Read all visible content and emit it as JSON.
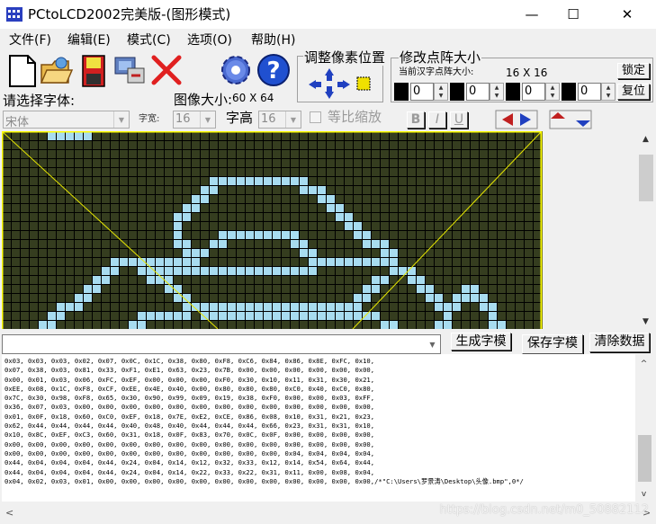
{
  "window": {
    "title": "PCtoLCD2002完美版-(图形模式)",
    "minimize_glyph": "—",
    "maximize_glyph": "☐",
    "close_glyph": "✕"
  },
  "menu": [
    "文件(F)",
    "编辑(E)",
    "模式(C)",
    "选项(O)",
    "帮助(H)"
  ],
  "toolbar": {
    "icons": [
      "new-file-icon",
      "open-folder-icon",
      "save-disk-icon",
      "export-icon",
      "close-x-icon",
      "settings-gear-icon",
      "help-icon"
    ]
  },
  "font_panel": {
    "choose_font_label": "请选择字体:",
    "font_value": "宋体",
    "font_width_label": "字宽:",
    "font_width_value": "16",
    "font_height_label": "字高",
    "font_height_value": "16",
    "proportional_label": "等比缩放",
    "bold_label": "B",
    "italic_label": "I",
    "underline_label": "U"
  },
  "image_size": {
    "label": "图像大小:",
    "value": "60 X 64"
  },
  "adjust_panel": {
    "title": "调整像素位置"
  },
  "dot_panel": {
    "title": "修改点阵大小",
    "current_label": "当前汉字点阵大小:",
    "current_value": "16 X 16",
    "lock_label": "锁定",
    "reset_label": "复位",
    "spin_values": [
      "0",
      "0",
      "0",
      "0"
    ]
  },
  "action_buttons": {
    "generate_label": "生成字模",
    "save_label": "保存字模",
    "clear_label": "清除数据"
  },
  "output_lines": [
    "0x03, 0x03, 0x03, 0x02, 0x07, 0x0C, 0x1C, 0x38, 0x80, 0xF8, 0xC6, 0x84, 0x86, 0x8E, 0xFC, 0x10,",
    "0x07, 0x38, 0x03, 0x81, 0x33, 0xF1, 0xE1, 0x63, 0x23, 0x7B, 0x00, 0x00, 0x00, 0x00, 0x00, 0x00,",
    "0x00, 0x01, 0x03, 0x06, 0xFC, 0xEF, 0x00, 0x00, 0x00, 0xF0, 0x30, 0x10, 0x11, 0x31, 0x30, 0x21,",
    "0xEE, 0x08, 0x1C, 0xF8, 0xCF, 0xEE, 0x4E, 0x40, 0x00, 0x80, 0x80, 0x80, 0xC0, 0x40, 0xC0, 0x80,",
    "0x7C, 0x30, 0x98, 0xF8, 0x65, 0x30, 0x90, 0x99, 0x09, 0x19, 0x38, 0xF0, 0x00, 0x00, 0x03, 0xFF,",
    "0x36, 0x07, 0x03, 0x00, 0x00, 0x00, 0x00, 0x00, 0x00, 0x00, 0x00, 0x00, 0x00, 0x00, 0x00, 0x00,",
    "0x01, 0x0F, 0x18, 0x60, 0xC0, 0xEF, 0x18, 0x7E, 0xE2, 0xCE, 0x86, 0x08, 0x10, 0x31, 0x21, 0x23,",
    "0x62, 0x44, 0x44, 0x44, 0x44, 0x40, 0x48, 0x40, 0x44, 0x44, 0x44, 0x66, 0x23, 0x31, 0x31, 0x10,",
    "0x10, 0x8C, 0xEF, 0xC3, 0x60, 0x31, 0x18, 0x0F, 0x83, 0x70, 0x0C, 0x0F, 0x00, 0x00, 0x00, 0x00,",
    "0x00, 0x00, 0x00, 0x00, 0x00, 0x00, 0x00, 0x00, 0x00, 0x00, 0x00, 0x00, 0x00, 0x00, 0x00, 0x00,",
    "0x00, 0x00, 0x00, 0x00, 0x00, 0x00, 0x00, 0x00, 0x00, 0x00, 0x00, 0x00, 0x04, 0x04, 0x04, 0x04,",
    "0x44, 0x04, 0x04, 0x04, 0x44, 0x24, 0x04, 0x14, 0x12, 0x32, 0x33, 0x12, 0x14, 0x54, 0x64, 0x44,",
    "0x44, 0x04, 0x04, 0x04, 0x44, 0x24, 0x04, 0x14, 0x22, 0x33, 0x22, 0x31, 0x11, 0x00, 0x08, 0x04,",
    "0x04, 0x02, 0x03, 0x01, 0x00, 0x00, 0x00, 0x00, 0x00, 0x00, 0x00, 0x00, 0x00, 0x00, 0x00, 0x00,/*\"C:\\Users\\罗景涛\\Desktop\\头像.bmp\",0*/"
  ],
  "watermark": "https://blog.csdn.net/m0_50882112",
  "colors": {
    "grid_background": "#353d1f",
    "grid_line": "#000000",
    "pixel_on": "#a8dcf0",
    "guide_line": "#e8e800",
    "canvas_border": "#ffff00"
  },
  "glyph_grid": {
    "cols": 60,
    "rows": 22,
    "on_cells": [
      [
        5,
        0
      ],
      [
        6,
        0
      ],
      [
        7,
        0
      ],
      [
        8,
        0
      ],
      [
        9,
        0
      ],
      [
        23,
        5
      ],
      [
        24,
        5
      ],
      [
        25,
        5
      ],
      [
        26,
        5
      ],
      [
        27,
        5
      ],
      [
        28,
        5
      ],
      [
        29,
        5
      ],
      [
        30,
        5
      ],
      [
        31,
        5
      ],
      [
        32,
        5
      ],
      [
        33,
        5
      ],
      [
        22,
        6
      ],
      [
        23,
        6
      ],
      [
        33,
        6
      ],
      [
        34,
        6
      ],
      [
        35,
        6
      ],
      [
        21,
        7
      ],
      [
        22,
        7
      ],
      [
        35,
        7
      ],
      [
        36,
        7
      ],
      [
        20,
        8
      ],
      [
        21,
        8
      ],
      [
        36,
        8
      ],
      [
        37,
        8
      ],
      [
        19,
        9
      ],
      [
        20,
        9
      ],
      [
        37,
        9
      ],
      [
        38,
        9
      ],
      [
        19,
        10
      ],
      [
        38,
        10
      ],
      [
        39,
        10
      ],
      [
        19,
        11
      ],
      [
        24,
        11
      ],
      [
        25,
        11
      ],
      [
        26,
        11
      ],
      [
        27,
        11
      ],
      [
        28,
        11
      ],
      [
        29,
        11
      ],
      [
        30,
        11
      ],
      [
        31,
        11
      ],
      [
        32,
        11
      ],
      [
        39,
        11
      ],
      [
        40,
        11
      ],
      [
        19,
        12
      ],
      [
        20,
        12
      ],
      [
        23,
        12
      ],
      [
        24,
        12
      ],
      [
        32,
        12
      ],
      [
        33,
        12
      ],
      [
        40,
        12
      ],
      [
        41,
        12
      ],
      [
        42,
        12
      ],
      [
        20,
        13
      ],
      [
        21,
        13
      ],
      [
        22,
        13
      ],
      [
        33,
        13
      ],
      [
        34,
        13
      ],
      [
        42,
        13
      ],
      [
        43,
        13
      ],
      [
        12,
        14
      ],
      [
        13,
        14
      ],
      [
        14,
        14
      ],
      [
        15,
        14
      ],
      [
        16,
        14
      ],
      [
        17,
        14
      ],
      [
        18,
        14
      ],
      [
        19,
        14
      ],
      [
        20,
        14
      ],
      [
        21,
        14
      ],
      [
        34,
        14
      ],
      [
        35,
        14
      ],
      [
        36,
        14
      ],
      [
        37,
        14
      ],
      [
        38,
        14
      ],
      [
        39,
        14
      ],
      [
        40,
        14
      ],
      [
        41,
        14
      ],
      [
        42,
        14
      ],
      [
        43,
        14
      ],
      [
        11,
        15
      ],
      [
        12,
        15
      ],
      [
        15,
        15
      ],
      [
        16,
        15
      ],
      [
        17,
        15
      ],
      [
        18,
        15
      ],
      [
        19,
        15
      ],
      [
        20,
        15
      ],
      [
        21,
        15
      ],
      [
        22,
        15
      ],
      [
        23,
        15
      ],
      [
        24,
        15
      ],
      [
        25,
        15
      ],
      [
        26,
        15
      ],
      [
        27,
        15
      ],
      [
        28,
        15
      ],
      [
        29,
        15
      ],
      [
        30,
        15
      ],
      [
        31,
        15
      ],
      [
        32,
        15
      ],
      [
        33,
        15
      ],
      [
        34,
        15
      ],
      [
        43,
        15
      ],
      [
        44,
        15
      ],
      [
        45,
        15
      ],
      [
        10,
        16
      ],
      [
        11,
        16
      ],
      [
        16,
        16
      ],
      [
        17,
        16
      ],
      [
        18,
        16
      ],
      [
        41,
        16
      ],
      [
        42,
        16
      ],
      [
        45,
        16
      ],
      [
        46,
        16
      ],
      [
        9,
        17
      ],
      [
        10,
        17
      ],
      [
        18,
        17
      ],
      [
        19,
        17
      ],
      [
        40,
        17
      ],
      [
        41,
        17
      ],
      [
        46,
        17
      ],
      [
        47,
        17
      ],
      [
        51,
        17
      ],
      [
        52,
        17
      ],
      [
        8,
        18
      ],
      [
        9,
        18
      ],
      [
        19,
        18
      ],
      [
        20,
        18
      ],
      [
        39,
        18
      ],
      [
        40,
        18
      ],
      [
        47,
        18
      ],
      [
        48,
        18
      ],
      [
        50,
        18
      ],
      [
        51,
        18
      ],
      [
        52,
        18
      ],
      [
        53,
        18
      ],
      [
        6,
        19
      ],
      [
        7,
        19
      ],
      [
        8,
        19
      ],
      [
        20,
        19
      ],
      [
        21,
        19
      ],
      [
        22,
        19
      ],
      [
        23,
        19
      ],
      [
        24,
        19
      ],
      [
        25,
        19
      ],
      [
        26,
        19
      ],
      [
        27,
        19
      ],
      [
        28,
        19
      ],
      [
        29,
        19
      ],
      [
        30,
        19
      ],
      [
        31,
        19
      ],
      [
        32,
        19
      ],
      [
        33,
        19
      ],
      [
        34,
        19
      ],
      [
        35,
        19
      ],
      [
        36,
        19
      ],
      [
        37,
        19
      ],
      [
        38,
        19
      ],
      [
        39,
        19
      ],
      [
        48,
        19
      ],
      [
        49,
        19
      ],
      [
        50,
        19
      ],
      [
        53,
        19
      ],
      [
        54,
        19
      ],
      [
        5,
        20
      ],
      [
        6,
        20
      ],
      [
        15,
        20
      ],
      [
        16,
        20
      ],
      [
        17,
        20
      ],
      [
        18,
        20
      ],
      [
        19,
        20
      ],
      [
        20,
        20
      ],
      [
        22,
        20
      ],
      [
        23,
        20
      ],
      [
        24,
        20
      ],
      [
        25,
        20
      ],
      [
        26,
        20
      ],
      [
        27,
        20
      ],
      [
        28,
        20
      ],
      [
        29,
        20
      ],
      [
        30,
        20
      ],
      [
        31,
        20
      ],
      [
        32,
        20
      ],
      [
        33,
        20
      ],
      [
        34,
        20
      ],
      [
        35,
        20
      ],
      [
        36,
        20
      ],
      [
        37,
        20
      ],
      [
        38,
        20
      ],
      [
        39,
        20
      ],
      [
        40,
        20
      ],
      [
        41,
        20
      ],
      [
        49,
        20
      ],
      [
        54,
        20
      ],
      [
        4,
        21
      ],
      [
        5,
        21
      ],
      [
        14,
        21
      ],
      [
        15,
        21
      ],
      [
        42,
        21
      ],
      [
        43,
        21
      ],
      [
        48,
        21
      ],
      [
        49,
        21
      ],
      [
        54,
        21
      ],
      [
        55,
        21
      ]
    ]
  }
}
